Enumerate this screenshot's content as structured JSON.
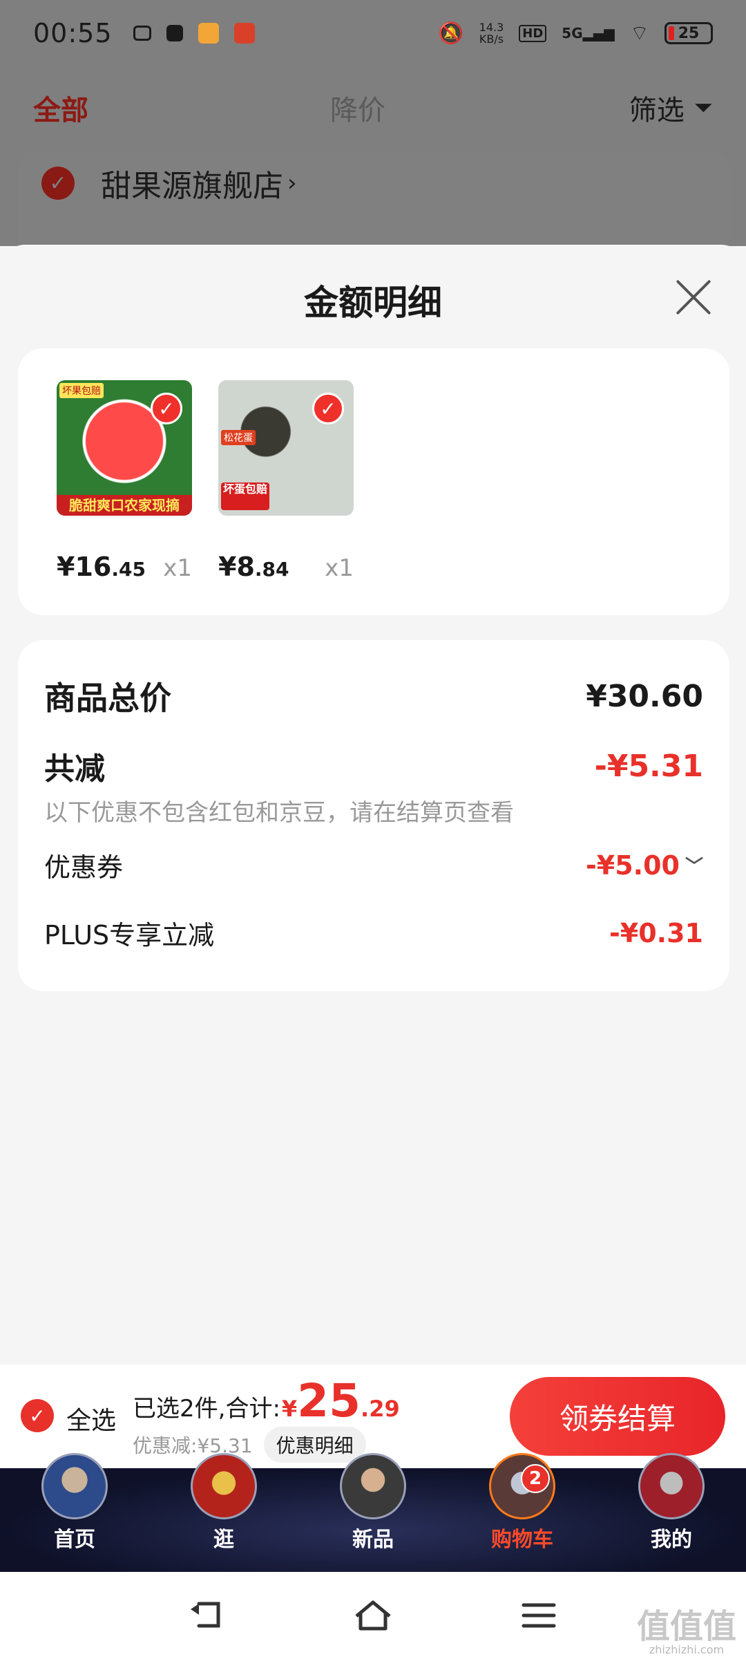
{
  "status_bar": {
    "time": "00:55",
    "net_speed_value": "14.3",
    "net_speed_unit": "KB/s",
    "hd": "HD",
    "network": "5G",
    "battery": "25"
  },
  "background_page": {
    "tabs": [
      "全部",
      "降价",
      "筛选"
    ],
    "store_name": "甜果源旗舰店"
  },
  "sheet": {
    "title": "金额明细",
    "goods": [
      {
        "price_int": "¥16",
        "price_dec": ".45",
        "qty": "x1",
        "ribbon": "脆甜爽口农家现摘",
        "tag": "坏果包赔",
        "icon": "watermelon-image"
      },
      {
        "price_int": "¥8",
        "price_dec": ".84",
        "qty": "x1",
        "ribbon": "坏蛋包赔",
        "tag": "松花蛋",
        "icon": "preserved-egg-image"
      }
    ],
    "total_label": "商品总价",
    "total_value": "¥30.60",
    "reduce_label": "共减",
    "reduce_value": "-¥5.31",
    "reduce_note": "以下优惠不包含红包和京豆，请在结算页查看",
    "coupon_label": "优惠券",
    "coupon_value": "-¥5.00",
    "plus_label": "PLUS专享立减",
    "plus_value": "-¥0.31"
  },
  "checkout": {
    "select_all": "全选",
    "summary_prefix": "已选2件,合计:",
    "yen": "¥",
    "amount_int": "25",
    "amount_dec": ".29",
    "discount_text": "优惠减:¥5.31",
    "detail_button": "优惠明细",
    "checkout_button": "领券结算"
  },
  "tab_bar": {
    "items": [
      {
        "label": "首页",
        "icon": "captain-america-avatar"
      },
      {
        "label": "逛",
        "icon": "iron-man-avatar"
      },
      {
        "label": "新品",
        "icon": "thor-avatar"
      },
      {
        "label": "购物车",
        "icon": "war-machine-avatar",
        "badge": "2",
        "active": true
      },
      {
        "label": "我的",
        "icon": "ant-man-avatar"
      }
    ]
  },
  "watermark": {
    "big": "值值值",
    "small": "zhizhizhi.com"
  },
  "colors": {
    "accent": "#e8312a",
    "tab_active": "#ff4a2a",
    "overlay": "#7f7f7f"
  }
}
